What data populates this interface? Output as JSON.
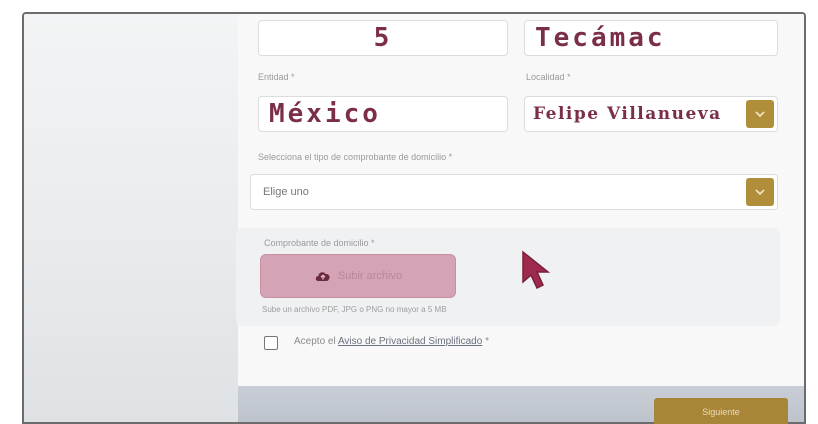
{
  "form": {
    "top_row": {
      "left_value": "5",
      "right_value": "Tecámac"
    },
    "entidad": {
      "label": "Entidad *",
      "value": "México"
    },
    "localidad": {
      "label": "Localidad *",
      "value": "Felipe Villanueva"
    },
    "comprobante_tipo": {
      "label": "Selecciona el tipo de comprobante de domicilio *",
      "selected": "Elige uno"
    },
    "upload": {
      "label": "Comprobante de domicilio *",
      "button_label": "Subir archivo",
      "hint": "Sube un archivo PDF, JPG o PNG no mayor a 5 MB"
    },
    "consent": {
      "prefix": "Acepto el",
      "link_text": "Aviso de Privacidad Simplificado",
      "suffix": "*",
      "checked": false
    },
    "next_button_label": "Siguiente"
  },
  "colors": {
    "accent_gold": "#b18f3a",
    "value_maroon": "#7a2f47",
    "upload_pink": "#d5a3b6",
    "cursor_maroon": "#9e2a4d"
  }
}
